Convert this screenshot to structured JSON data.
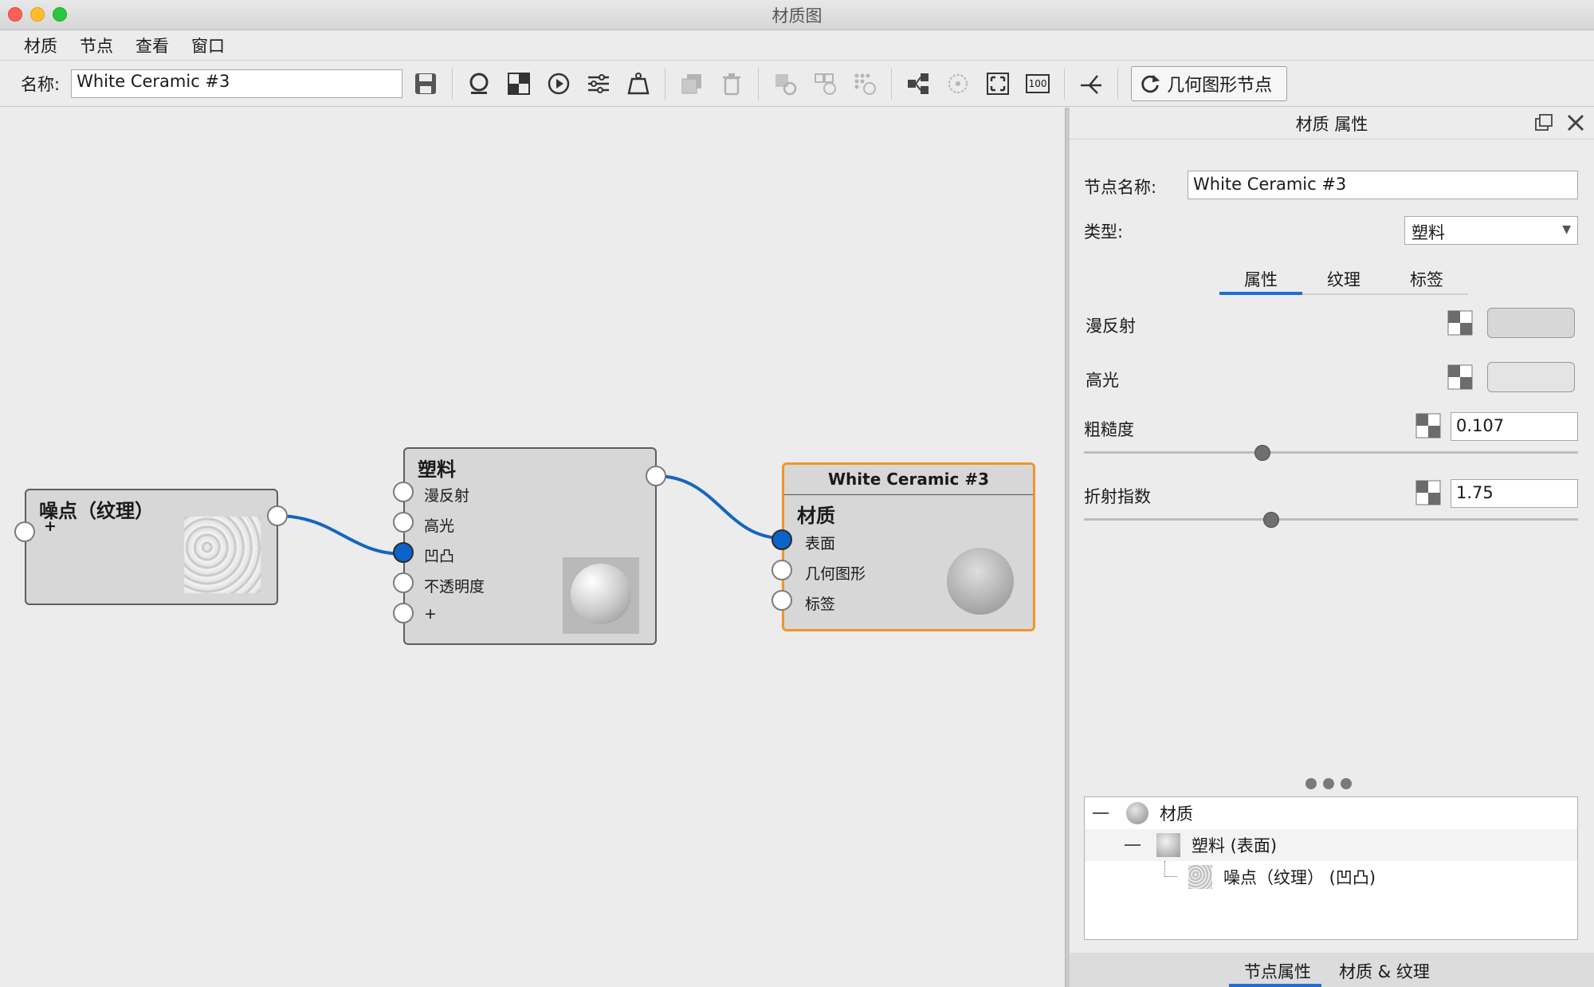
{
  "window": {
    "title": "材质图"
  },
  "menu": [
    "材质",
    "节点",
    "查看",
    "窗口"
  ],
  "toolbar": {
    "name_label": "名称:",
    "name_value": "White Ceramic #3",
    "geometry_button": "几何图形节点",
    "zoom_badge": "100"
  },
  "nodes": {
    "noise": {
      "title": "噪点（纹理）",
      "add_port": "+"
    },
    "plastic": {
      "title": "塑料",
      "ports": [
        "漫反射",
        "高光",
        "凹凸",
        "不透明度",
        "+"
      ]
    },
    "material": {
      "header": "White Ceramic #3",
      "title": "材质",
      "ports": [
        "表面",
        "几何图形",
        "标签"
      ]
    }
  },
  "panel": {
    "title": "材质 属性",
    "node_name_label": "节点名称:",
    "node_name_value": "White Ceramic #3",
    "type_label": "类型:",
    "type_value": "塑料",
    "tabs": [
      "属性",
      "纹理",
      "标签"
    ],
    "active_tab": "属性",
    "props": {
      "diffuse_label": "漫反射",
      "specular_label": "高光",
      "roughness_label": "粗糙度",
      "roughness_value": "0.107",
      "ior_label": "折射指数",
      "ior_value": "1.75"
    },
    "tree": {
      "root": "材质",
      "child": "塑料 (表面)",
      "grandchild": "噪点（纹理） (凹凸)"
    },
    "bottom_tabs": [
      "节点属性",
      "材质 & 纹理"
    ]
  },
  "colors": {
    "wire": "#1565c0",
    "selected_border": "#f0962b",
    "tab_accent": "#1f6fd1"
  }
}
